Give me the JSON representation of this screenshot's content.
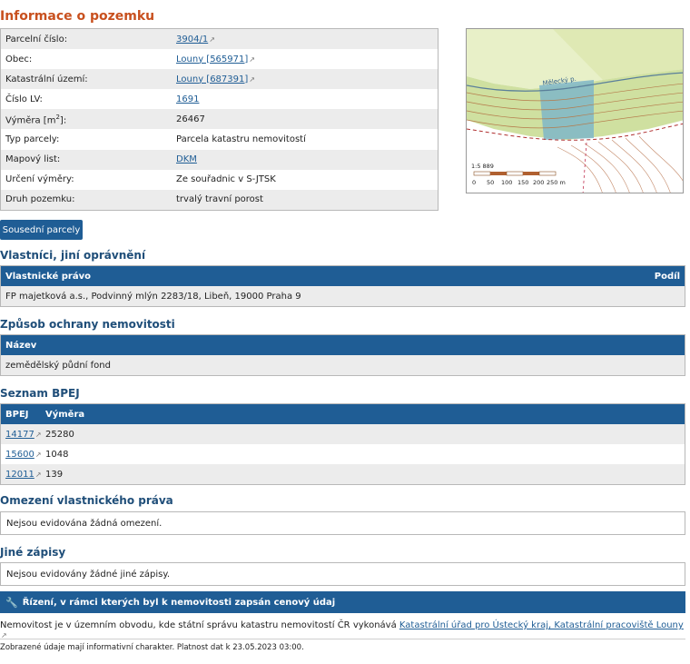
{
  "page_title": "Informace o pozemku",
  "info_rows": [
    {
      "label": "Parcelní číslo:",
      "value": "3904/1",
      "link": true
    },
    {
      "label": "Obec:",
      "value": "Louny [565971]",
      "link": true
    },
    {
      "label": "Katastrální území:",
      "value": "Louny [687391]",
      "link": true
    },
    {
      "label": "Číslo LV:",
      "value": "1691",
      "link": true
    },
    {
      "label": "Výměra [m²]:",
      "value": "26467",
      "link": false
    },
    {
      "label": "Typ parcely:",
      "value": "Parcela katastru nemovitostí",
      "link": false
    },
    {
      "label": "Mapový list:",
      "value": "DKM",
      "link": true
    },
    {
      "label": "Určení výměry:",
      "value": "Ze souřadnic v S-JTSK",
      "link": false
    },
    {
      "label": "Druh pozemku:",
      "value": "trvalý travní porost",
      "link": false
    }
  ],
  "map": {
    "stream_label": "Mělecký p.",
    "scale_text": "1:5 889",
    "scale_ticks": [
      "0",
      "50",
      "100",
      "150",
      "200",
      "250 m"
    ]
  },
  "neighbors_button": "Sousední parcely",
  "owners": {
    "title": "Vlastníci, jiní oprávnění",
    "col1": "Vlastnické právo",
    "col2": "Podíl",
    "row": "FP majetková a.s., Podvinný mlýn 2283/18, Libeň, 19000 Praha 9"
  },
  "protection": {
    "title": "Způsob ochrany nemovitosti",
    "col1": "Název",
    "row": "zemědělský půdní fond"
  },
  "bpej": {
    "title": "Seznam BPEJ",
    "col1": "BPEJ",
    "col2": "Výměra",
    "rows": [
      {
        "code": "14177",
        "area": "25280"
      },
      {
        "code": "15600",
        "area": "1048"
      },
      {
        "code": "12011",
        "area": "139"
      }
    ]
  },
  "restrictions": {
    "title": "Omezení vlastnického práva",
    "text": "Nejsou evidována žádná omezení."
  },
  "other_records": {
    "title": "Jiné zápisy",
    "text": "Nejsou evidovány žádné jiné zápisy."
  },
  "proceedings_bar": "Řízení, v rámci kterých byl k nemovitosti zapsán cenový údaj",
  "note": {
    "text": "Nemovitost je v územním obvodu, kde státní správu katastru nemovitostí ČR vykonává ",
    "link": "Katastrální úřad pro Ústecký kraj, Katastrální pracoviště Louny"
  },
  "footer": "Zobrazené údaje mají informativní charakter. Platnost dat k 23.05.2023 03:00.",
  "colors": {
    "title_orange": "#c8501e",
    "header_blue": "#1f5d95",
    "link_blue": "#1f5d95"
  }
}
